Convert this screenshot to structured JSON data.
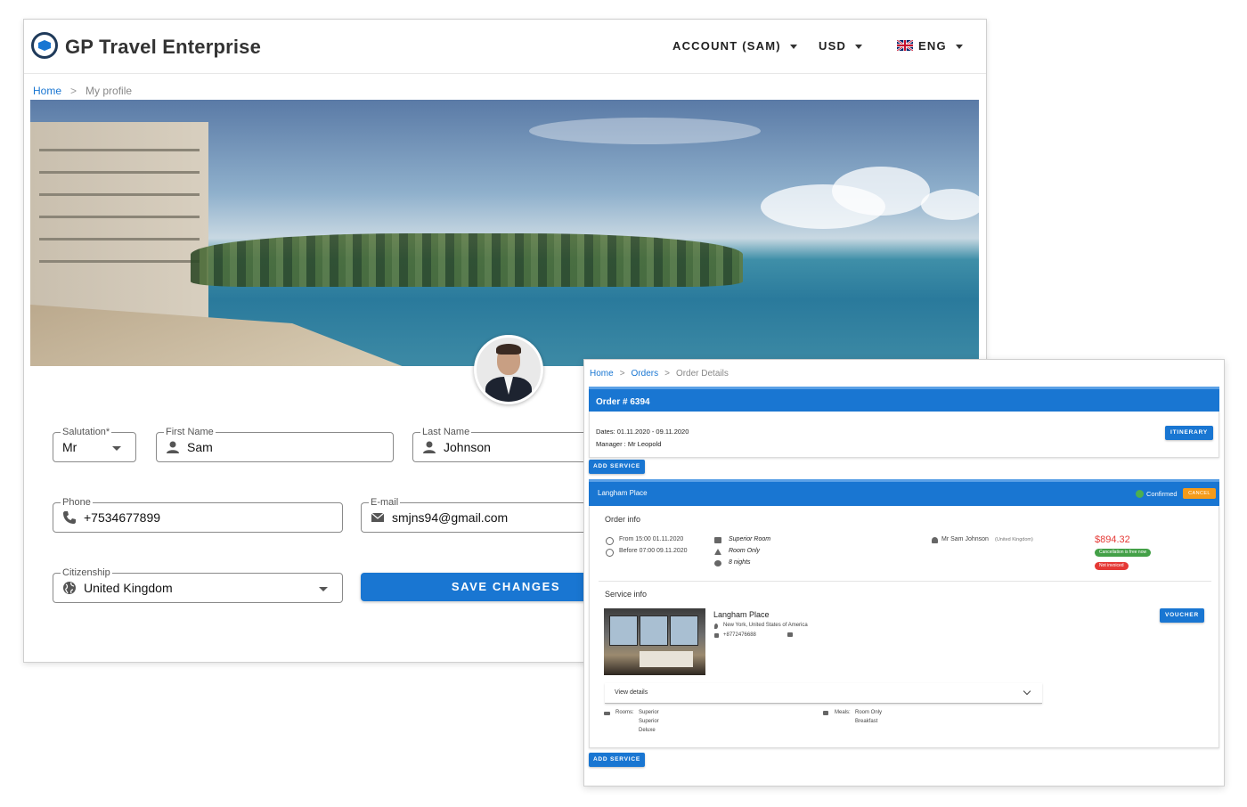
{
  "profile": {
    "brand": "GP Travel Enterprise",
    "nav": {
      "account": "ACCOUNT (SAM)",
      "currency": "USD",
      "language": "ENG"
    },
    "breadcrumb": {
      "home": "Home",
      "sep": ">",
      "current": "My profile"
    },
    "form": {
      "salutation": {
        "label": "Salutation*",
        "value": "Mr"
      },
      "first_name": {
        "label": "First Name",
        "value": "Sam"
      },
      "last_name": {
        "label": "Last Name",
        "value": "Johnson"
      },
      "phone": {
        "label": "Phone",
        "value": "+7534677899"
      },
      "email": {
        "label": "E-mail",
        "value": "smjns94@gmail.com"
      },
      "citizenship": {
        "label": "Citizenship",
        "value": "United Kingdom"
      },
      "save_label": "SAVE CHANGES"
    }
  },
  "order": {
    "breadcrumb": {
      "home": "Home",
      "sep": ">",
      "orders": "Orders",
      "current": "Order Details"
    },
    "title": "Order # 6394",
    "dates": "Dates: 01.11.2020 - 09.11.2020",
    "manager": "Manager : Mr Leopold",
    "itinerary_label": "ITINERARY",
    "add_service_label": "ADD SERVICE",
    "service": {
      "name": "Langham Place",
      "status": "Confirmed",
      "cancel_label": "CANCEL",
      "order_info_title": "Order info",
      "checkin": "From 15:00 01.11.2020",
      "checkout": "Before 07:00 09.11.2020",
      "room_type": "Superior Room",
      "board": "Room Only",
      "nights": "8 nights",
      "guest": "Mr Sam Johnson",
      "guest_country": "(United Kingdom)",
      "price": "$894.32",
      "cancellation_badge": "Cancellation is free now",
      "invoice_badge": "Not invoiced",
      "service_info_title": "Service info",
      "hotel_name": "Langham Place",
      "hotel_address": "New York, United States of America",
      "hotel_phone": "+8772476688",
      "voucher_label": "VOUCHER",
      "view_details_label": "View details",
      "rooms_label": "Rooms:",
      "rooms": [
        "Superior",
        "Superior",
        "Deluxe"
      ],
      "meals_label": "Meals:",
      "meals": [
        "Room Only",
        "Breakfast"
      ]
    }
  },
  "colors": {
    "primary": "#1976d2",
    "warning": "#f59b1a",
    "success": "#4caf50",
    "danger": "#e53935"
  }
}
